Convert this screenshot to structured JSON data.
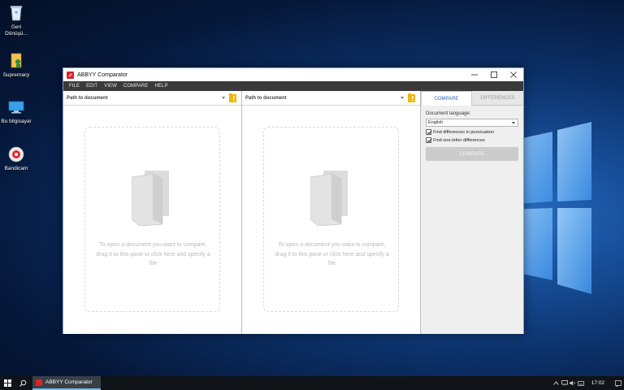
{
  "desktop": {
    "icons": [
      {
        "label": "Geri\nDönüşü..."
      },
      {
        "label": "Supremacy"
      },
      {
        "label": "Bu bilgisayar"
      },
      {
        "label": "Bandicam"
      }
    ]
  },
  "window": {
    "title": "ABBYY Comparator",
    "menu": [
      "FILE",
      "EDIT",
      "VIEW",
      "COMPARE",
      "HELP"
    ],
    "left_pane": {
      "path_placeholder": "Path to document",
      "hint": "To open a document you want to compare, drag it to this pane or click here and specify a file"
    },
    "right_pane": {
      "path_placeholder": "Path to document",
      "hint": "To open a document you want to compare, drag it to this pane or click here and specify a file"
    },
    "side": {
      "tabs": [
        "COMPARE",
        "DIFFERENCES"
      ],
      "active_tab": "COMPARE",
      "language_label": "Document language:",
      "language_value": "English",
      "checkbox_punctuation": "Find differences in punctuation",
      "checkbox_one_letter": "Find one-letter differences",
      "punctuation_checked": true,
      "one_letter_checked": true,
      "compare_button": "COMPARE"
    }
  },
  "taskbar": {
    "app_label": "ABBYY Comparator",
    "time": "17:02"
  },
  "colors": {
    "accent": "#2a66b8",
    "menubar": "#3a3a3a",
    "brand_red": "#d9242b",
    "desktop": "#0b2f66"
  }
}
